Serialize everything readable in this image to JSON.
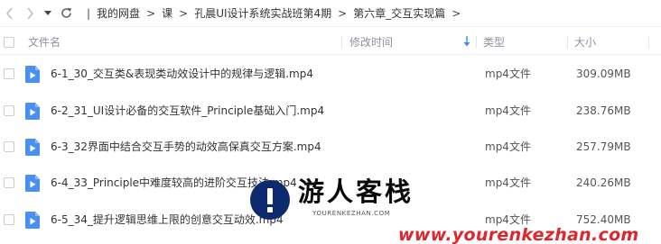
{
  "toolbar": {
    "back_icon": "chevron-left-icon",
    "forward_icon": "chevron-right-icon",
    "history_icon": "caret-down-icon",
    "refresh_icon": "refresh-icon"
  },
  "breadcrumb": [
    "我的网盘",
    "课",
    "孔晨UI设计系统实战班第4期",
    "第六章_交互实现篇"
  ],
  "table": {
    "columns": {
      "name": "文件名",
      "modified": "修改时间",
      "type": "类型",
      "size": "大小"
    },
    "sort": "modified-descending",
    "rows": [
      {
        "name": "6-1_30_交互类&表现类动效设计中的规律与逻辑.mp4",
        "type": "mp4文件",
        "size": "309.09MB"
      },
      {
        "name": "6-2_31_UI设计必备的交互软件_Principle基础入门.mp4",
        "type": "mp4文件",
        "size": "238.76MB"
      },
      {
        "name": "6-3_32界面中结合交互手势的动效高保真交互方案.mp4",
        "type": "mp4文件",
        "size": "257.79MB"
      },
      {
        "name": "6-4_33_Principle中难度较高的进阶交互技法.mp4",
        "type": "mp4文件",
        "size": "240.26MB"
      },
      {
        "name": "6-5_34_提升逻辑思维上限的创意交互动效.mp4",
        "type": "mp4文件",
        "size": "752.40MB"
      }
    ]
  },
  "watermark": {
    "title": "游人客栈",
    "subtitle": "YOURENKEZHAN.COM",
    "url": "www.yourenkezhan.com"
  },
  "colors": {
    "file_icon": "#4a90f0",
    "sort_arrow": "#3b8cff",
    "watermark_url": "#e0262d"
  }
}
